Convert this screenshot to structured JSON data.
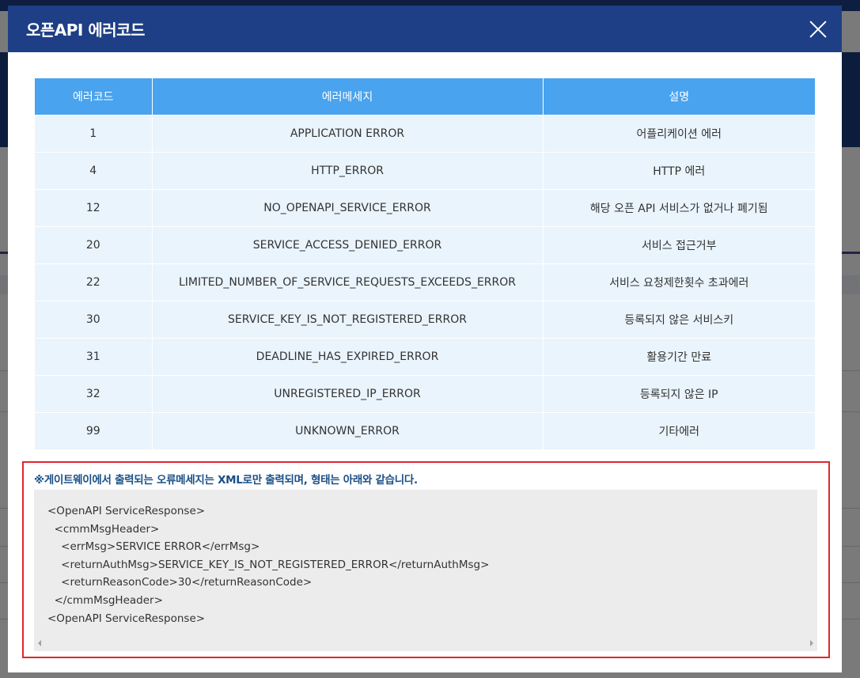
{
  "modal": {
    "title": "오픈API 에러코드"
  },
  "table": {
    "headers": [
      "에러코드",
      "에러메세지",
      "설명"
    ],
    "rows": [
      {
        "code": "1",
        "message": "APPLICATION ERROR",
        "description": "어플리케이션 에러"
      },
      {
        "code": "4",
        "message": "HTTP_ERROR",
        "description": "HTTP 에러"
      },
      {
        "code": "12",
        "message": "NO_OPENAPI_SERVICE_ERROR",
        "description": "해당 오픈 API 서비스가 없거나 폐기됨"
      },
      {
        "code": "20",
        "message": "SERVICE_ACCESS_DENIED_ERROR",
        "description": "서비스 접근거부"
      },
      {
        "code": "22",
        "message": "LIMITED_NUMBER_OF_SERVICE_REQUESTS_EXCEEDS_ERROR",
        "description": "서비스 요청제한횟수 초과에러"
      },
      {
        "code": "30",
        "message": "SERVICE_KEY_IS_NOT_REGISTERED_ERROR",
        "description": "등록되지 않은 서비스키"
      },
      {
        "code": "31",
        "message": "DEADLINE_HAS_EXPIRED_ERROR",
        "description": "활용기간 만료"
      },
      {
        "code": "32",
        "message": "UNREGISTERED_IP_ERROR",
        "description": "등록되지 않은 IP"
      },
      {
        "code": "99",
        "message": "UNKNOWN_ERROR",
        "description": "기타에러"
      }
    ]
  },
  "note": {
    "title": "※게이트웨이에서 출력되는 오류메세지는 XML로만 출력되며, 형태는 아래와 같습니다.",
    "code_lines": [
      "<OpenAPI ServiceResponse>",
      "  <cmmMsgHeader>",
      "    <errMsg>SERVICE ERROR</errMsg>",
      "    <returnAuthMsg>SERVICE_KEY_IS_NOT_REGISTERED_ERROR</returnAuthMsg>",
      "    <returnReasonCode>30</returnReasonCode>",
      "  </cmmMsgHeader>",
      "<OpenAPI ServiceResponse>"
    ]
  },
  "colors": {
    "header_bg": "#1e3f86",
    "table_header_bg": "#49a3ee",
    "table_cell_bg": "#eaf4fd",
    "highlight_border": "#e0262d",
    "note_title": "#1a4f86"
  },
  "icons": {
    "close": "close-icon"
  }
}
